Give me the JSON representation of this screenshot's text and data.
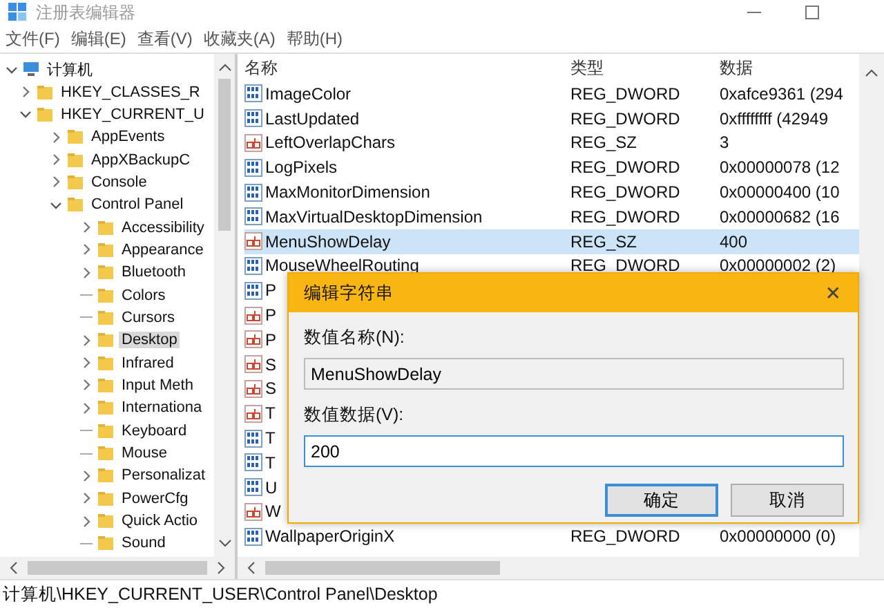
{
  "window": {
    "title": "注册表编辑器"
  },
  "menu": [
    "文件(F)",
    "编辑(E)",
    "查看(V)",
    "收藏夹(A)",
    "帮助(H)"
  ],
  "tree": [
    {
      "label": "计算机",
      "expandable": true,
      "expanded": true,
      "selected": false,
      "children": [
        {
          "label": "HKEY_CLASSES_R",
          "expandable": true,
          "expanded": false,
          "selected": false
        },
        {
          "label": "HKEY_CURRENT_U",
          "expandable": true,
          "expanded": true,
          "selected": false,
          "children": [
            {
              "label": "AppEvents",
              "expandable": true,
              "expanded": false,
              "selected": false
            },
            {
              "label": "AppXBackupC",
              "expandable": true,
              "expanded": false,
              "selected": false
            },
            {
              "label": "Console",
              "expandable": true,
              "expanded": false,
              "selected": false
            },
            {
              "label": "Control Panel",
              "expandable": true,
              "expanded": true,
              "selected": false,
              "children": [
                {
                  "label": "Accessibility",
                  "expandable": true,
                  "expanded": false,
                  "selected": false
                },
                {
                  "label": "Appearance",
                  "expandable": true,
                  "expanded": false,
                  "selected": false
                },
                {
                  "label": "Bluetooth",
                  "expandable": true,
                  "expanded": false,
                  "selected": false
                },
                {
                  "label": "Colors",
                  "expandable": false,
                  "selected": false
                },
                {
                  "label": "Cursors",
                  "expandable": false,
                  "selected": false
                },
                {
                  "label": "Desktop",
                  "expandable": true,
                  "expanded": false,
                  "selected": true
                },
                {
                  "label": "Infrared",
                  "expandable": true,
                  "expanded": false,
                  "selected": false
                },
                {
                  "label": "Input Meth",
                  "expandable": true,
                  "expanded": false,
                  "selected": false
                },
                {
                  "label": "Internationa",
                  "expandable": true,
                  "expanded": false,
                  "selected": false
                },
                {
                  "label": "Keyboard",
                  "expandable": false,
                  "selected": false
                },
                {
                  "label": "Mouse",
                  "expandable": false,
                  "selected": false
                },
                {
                  "label": "Personalizat",
                  "expandable": true,
                  "expanded": false,
                  "selected": false
                },
                {
                  "label": "PowerCfg",
                  "expandable": true,
                  "expanded": false,
                  "selected": false
                },
                {
                  "label": "Quick Actio",
                  "expandable": true,
                  "expanded": false,
                  "selected": false
                },
                {
                  "label": "Sound",
                  "expandable": false,
                  "selected": false
                }
              ]
            }
          ]
        }
      ]
    }
  ],
  "table": {
    "columns": [
      "名称",
      "类型",
      "数据"
    ],
    "rows": [
      {
        "kind": "dword",
        "name": "ImageColor",
        "type": "REG_DWORD",
        "data": "0xafce9361 (294",
        "selected": false
      },
      {
        "kind": "dword",
        "name": "LastUpdated",
        "type": "REG_DWORD",
        "data": "0xffffffff (42949",
        "selected": false
      },
      {
        "kind": "string",
        "name": "LeftOverlapChars",
        "type": "REG_SZ",
        "data": "3",
        "selected": false
      },
      {
        "kind": "dword",
        "name": "LogPixels",
        "type": "REG_DWORD",
        "data": "0x00000078 (12",
        "selected": false
      },
      {
        "kind": "dword",
        "name": "MaxMonitorDimension",
        "type": "REG_DWORD",
        "data": "0x00000400 (10",
        "selected": false
      },
      {
        "kind": "dword",
        "name": "MaxVirtualDesktopDimension",
        "type": "REG_DWORD",
        "data": "0x00000682 (16",
        "selected": false
      },
      {
        "kind": "string",
        "name": "MenuShowDelay",
        "type": "REG_SZ",
        "data": "400",
        "selected": true
      },
      {
        "kind": "dword",
        "name": "MouseWheelRouting",
        "type": "REG_DWORD",
        "data": "0x00000002 (2)",
        "selected": false
      },
      {
        "kind": "dword",
        "name": "P",
        "selected": false
      },
      {
        "kind": "string",
        "name": "P",
        "selected": false
      },
      {
        "kind": "string",
        "name": "P",
        "selected": false
      },
      {
        "kind": "string",
        "name": "S",
        "selected": false
      },
      {
        "kind": "string",
        "name": "S",
        "selected": false
      },
      {
        "kind": "string",
        "name": "T",
        "selected": false
      },
      {
        "kind": "dword",
        "name": "T",
        "selected": false
      },
      {
        "kind": "dword",
        "name": "T",
        "selected": false
      },
      {
        "kind": "dword",
        "name": "U",
        "selected": false
      },
      {
        "kind": "string",
        "name": "W",
        "selected": false
      },
      {
        "kind": "dword",
        "name": "WallpaperOriginX",
        "type": "REG_DWORD",
        "data": "0x00000000 (0)",
        "selected": false
      }
    ]
  },
  "dialog": {
    "title": "编辑字符串",
    "close": "✕",
    "name_label": "数值名称(N):",
    "name_value": "MenuShowDelay",
    "data_label": "数值数据(V):",
    "data_value": "200",
    "buttons": [
      {
        "label": "确定",
        "default": true
      },
      {
        "label": "取消",
        "default": false
      }
    ]
  },
  "status_bar": "计算机\\HKEY_CURRENT_USER\\Control Panel\\Desktop"
}
